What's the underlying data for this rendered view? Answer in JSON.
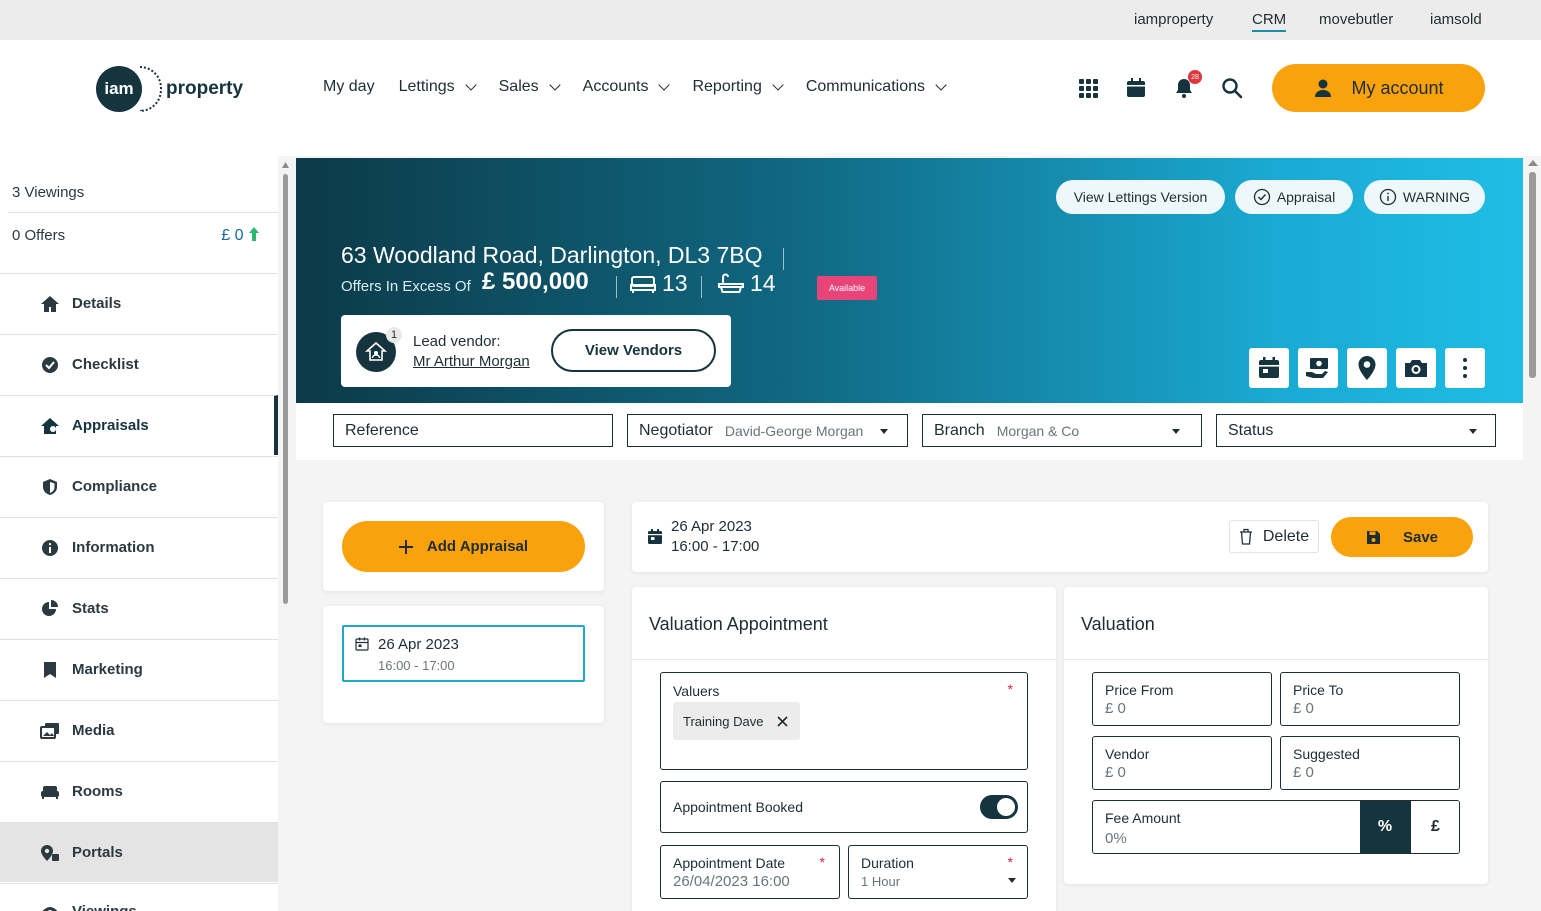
{
  "top_links": [
    "iamproperty",
    "CRM",
    "movebutler",
    "iamsold"
  ],
  "logo": {
    "mark": "iam",
    "word": "property"
  },
  "nav": [
    "My day",
    "Lettings",
    "Sales",
    "Accounts",
    "Reporting",
    "Communications"
  ],
  "header": {
    "notifications_count": "28",
    "my_account_label": "My account"
  },
  "sidebar": {
    "viewings_count": "3 Viewings",
    "offers_count": "0 Offers",
    "offers_value": "£ 0",
    "items": [
      "Details",
      "Checklist",
      "Appraisals",
      "Compliance",
      "Information",
      "Stats",
      "Marketing",
      "Media",
      "Rooms",
      "Portals",
      "Viewings"
    ]
  },
  "property": {
    "address": "63 Woodland Road, Darlington, DL3 7BQ",
    "price_qualifier": "Offers In Excess Of",
    "price": "£ 500,000",
    "bedrooms": "13",
    "bathrooms": "14",
    "status_badge": "Available",
    "buttons": {
      "lettings": "View Lettings Version",
      "appraisal": "Appraisal",
      "warning": "WARNING"
    },
    "vendor": {
      "count": "1",
      "label": "Lead vendor:",
      "name": "Mr Arthur Morgan",
      "button": "View Vendors"
    }
  },
  "filters": {
    "reference": "Reference",
    "negotiator_label": "Negotiator",
    "negotiator_value": "David-George Morgan",
    "branch_label": "Branch",
    "branch_value": "Morgan & Co",
    "status_label": "Status"
  },
  "appraisals": {
    "add_label": "Add Appraisal",
    "list": [
      {
        "date": "26 Apr 2023",
        "time": "16:00 - 17:00"
      }
    ]
  },
  "appointment_header": {
    "date": "26 Apr 2023",
    "time": "16:00 - 17:00",
    "delete_label": "Delete",
    "save_label": "Save"
  },
  "valuation_appointment": {
    "title": "Valuation Appointment",
    "valuers_label": "Valuers",
    "valuers": [
      "Training Dave"
    ],
    "booked_label": "Appointment Booked",
    "booked": true,
    "date_label": "Appointment Date",
    "date_value": "26/04/2023 16:00",
    "duration_label": "Duration",
    "duration_value": "1 Hour",
    "required_mark": "*"
  },
  "valuation": {
    "title": "Valuation",
    "price_from_label": "Price From",
    "price_from_value": "£ 0",
    "price_to_label": "Price To",
    "price_to_value": "£ 0",
    "vendor_label": "Vendor",
    "vendor_value": "£ 0",
    "suggested_label": "Suggested",
    "suggested_value": "£ 0",
    "fee_label": "Fee Amount",
    "fee_value": "0%",
    "fee_mode_percent": "%",
    "fee_mode_pound": "£"
  },
  "colors": {
    "accent": "#f9a20c",
    "brand_dark": "#15343d",
    "teal": "#20a8c7",
    "badge_pink": "#e8447a"
  }
}
